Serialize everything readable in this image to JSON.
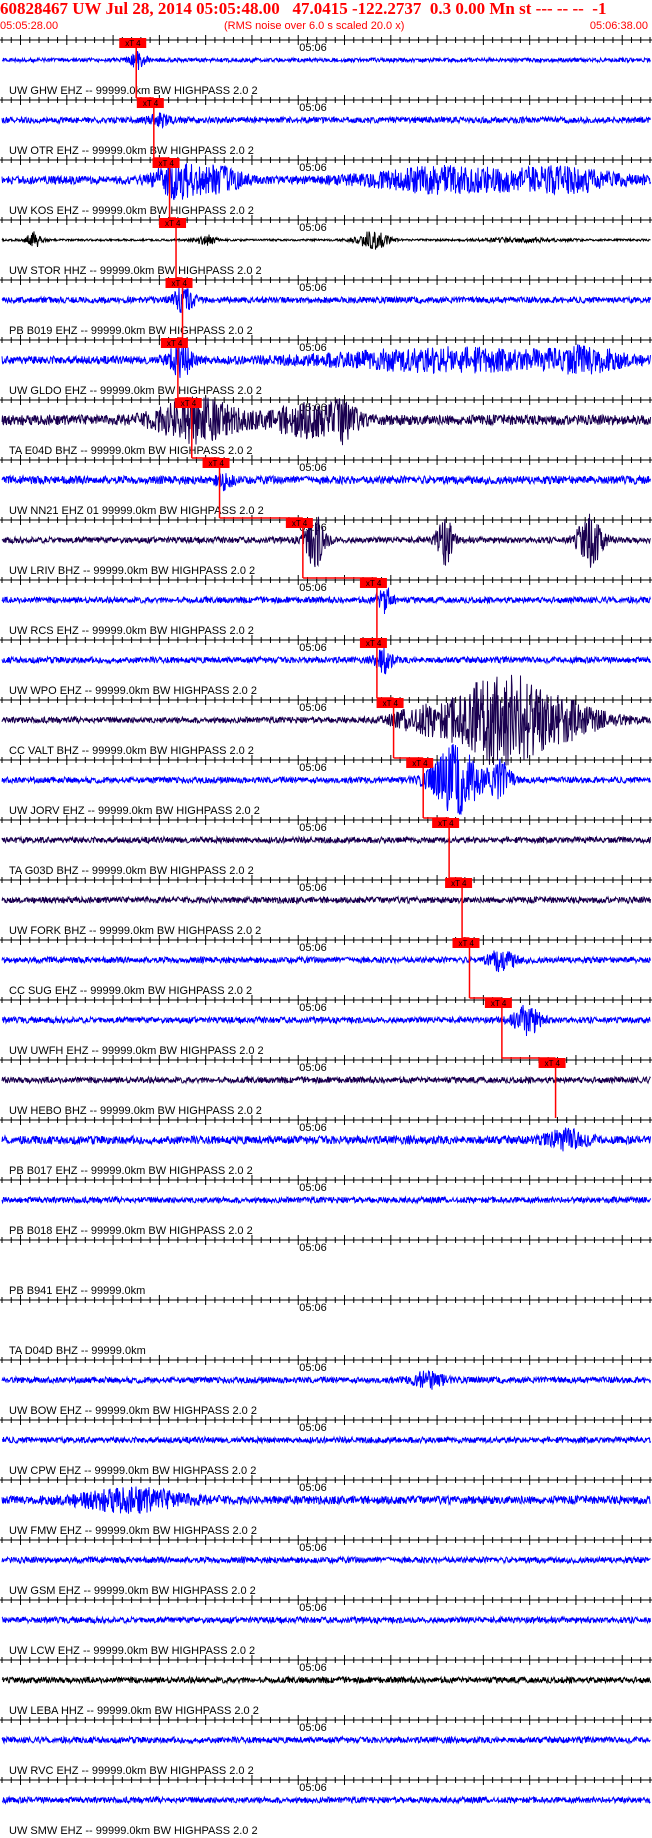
{
  "header": {
    "title": "60828467 UW Jul 28, 2014 05:05:48.00   47.0415 -122.2737  0.3 0.00 Mn st --- -- --  -1",
    "start_time": "05:05:28.00",
    "note": "(RMS noise over 6.0 s scaled 20.0 x)",
    "end_time": "05:06:38.00"
  },
  "colors": {
    "header": "#ff0000",
    "blue": "#0000ff",
    "dark": "#1a0050",
    "black": "#000000",
    "pick": "#ff0000",
    "axis": "#000000"
  },
  "chart_data": {
    "type": "line",
    "title": "60828467 UW Jul 28, 2014 05:05:48.00   47.0415 -122.2737  0.3 0.00 Mn st --- -- --  -1",
    "x_range": [
      "05:05:28.00",
      "05:06:38.00"
    ],
    "tick_label": "05:06",
    "tick_label_time": "05:06:00",
    "tick_interval_s": 1,
    "pick_label": "xT 4",
    "grid": false,
    "legend": "none",
    "traces": [
      {
        "label": "UW GHW EHZ -- 99999.0km BW  HIGHPASS  2.0  2",
        "color": "blue",
        "amp": 2,
        "pick": 14.5,
        "events": [
          {
            "t": 14.6,
            "a": 9,
            "w": 0.6
          }
        ]
      },
      {
        "label": "UW OTR EHZ -- 99999.0km BW  HIGHPASS  2.0  2",
        "color": "blue",
        "amp": 3,
        "pick": 16.4,
        "events": [
          {
            "t": 17,
            "a": 5,
            "w": 0.8
          }
        ]
      },
      {
        "label": "UW KOS EHZ -- 99999.0km BW  HIGHPASS  2.0  2",
        "color": "blue",
        "amp": 4,
        "pick": 18.1,
        "events": [
          {
            "t": 18.6,
            "a": 16,
            "w": 1.5
          },
          {
            "t": 23,
            "a": 12,
            "w": 2
          },
          {
            "t": 48,
            "a": 11,
            "w": 6
          },
          {
            "t": 61,
            "a": 10,
            "w": 4
          }
        ]
      },
      {
        "label": "UW STOR HHZ -- 99999.0km BW  HIGHPASS  2.0  2",
        "color": "black",
        "amp": 1,
        "pick": 18.8,
        "events": [
          {
            "t": 3.5,
            "a": 8,
            "w": 0.6
          },
          {
            "t": 22,
            "a": 5,
            "w": 0.8
          },
          {
            "t": 40,
            "a": 9,
            "w": 1.2
          },
          {
            "t": 56,
            "a": 2,
            "w": 3
          }
        ]
      },
      {
        "label": "PB B019 EHZ -- 99999.0km BW  HIGHPASS  2.0  2",
        "color": "blue",
        "amp": 3,
        "pick": 19.5,
        "events": [
          {
            "t": 19.6,
            "a": 11,
            "w": 0.8
          }
        ]
      },
      {
        "label": "UW GLDO EHZ -- 99999.0km BW  HIGHPASS  2.0  2",
        "color": "blue",
        "amp": 4,
        "pick": 19,
        "events": [
          {
            "t": 19.3,
            "a": 14,
            "w": 1
          },
          {
            "t": 48,
            "a": 10,
            "w": 9
          },
          {
            "t": 63,
            "a": 9,
            "w": 3
          }
        ]
      },
      {
        "label": "TA E04D BHZ -- 99999.0km BW  HIGHPASS  2.0  2",
        "color": "dark",
        "amp": 5,
        "pick": 20.5,
        "events": [
          {
            "t": 21,
            "a": 20,
            "w": 3
          },
          {
            "t": 33,
            "a": 14,
            "w": 3
          },
          {
            "t": 37,
            "a": 17,
            "w": 0.8
          }
        ]
      },
      {
        "label": "UW NN21 EHZ 01 99999.0km BW  HIGHPASS  2.0  2",
        "color": "blue",
        "amp": 4,
        "pick": 23.5,
        "events": [
          {
            "t": 24,
            "a": 8,
            "w": 0.6
          }
        ]
      },
      {
        "label": "UW LRIV BHZ -- 99999.0km BW  HIGHPASS  2.0  2",
        "color": "dark",
        "amp": 3,
        "pick": 32.5,
        "events": [
          {
            "t": 33.8,
            "a": 26,
            "w": 0.8
          },
          {
            "t": 47.8,
            "a": 24,
            "w": 0.6
          },
          {
            "t": 63.5,
            "a": 26,
            "w": 0.9
          }
        ]
      },
      {
        "label": "UW RCS EHZ -- 99999.0km BW  HIGHPASS  2.0  2",
        "color": "blue",
        "amp": 3,
        "pick": 40.5,
        "events": [
          {
            "t": 41.3,
            "a": 12,
            "w": 0.6
          }
        ]
      },
      {
        "label": "UW WPO EHZ -- 99999.0km BW  HIGHPASS  2.0  2",
        "color": "blue",
        "amp": 3,
        "pick": 40.5,
        "events": [
          {
            "t": 41.2,
            "a": 13,
            "w": 0.6
          }
        ]
      },
      {
        "label": "CC VALT BHZ -- 99999.0km BW  HIGHPASS  2.0  2",
        "color": "dark",
        "amp": 3,
        "pick": 42.3,
        "events": [
          {
            "t": 45,
            "a": 10,
            "w": 2
          },
          {
            "t": 53,
            "a": 38,
            "w": 3.5
          },
          {
            "t": 59,
            "a": 20,
            "w": 4
          }
        ]
      },
      {
        "label": "UW JORV EHZ -- 99999.0km BW  HIGHPASS  2.0  2",
        "color": "blue",
        "amp": 3,
        "pick": 45.5,
        "events": [
          {
            "t": 49,
            "a": 34,
            "w": 1.8
          },
          {
            "t": 53.8,
            "a": 18,
            "w": 0.8
          }
        ]
      },
      {
        "label": "TA G03D BHZ -- 99999.0km BW  HIGHPASS  2.0  2",
        "color": "dark",
        "amp": 3,
        "pick": 48.3,
        "events": []
      },
      {
        "label": "UW FORK BHZ -- 99999.0km BW  HIGHPASS  2.0  2",
        "color": "dark",
        "amp": 3,
        "pick": 49.7,
        "events": []
      },
      {
        "label": "CC SUG EHZ -- 99999.0km BW  HIGHPASS  2.0  2",
        "color": "blue",
        "amp": 3,
        "pick": 50.5,
        "events": [
          {
            "t": 54,
            "a": 10,
            "w": 1
          }
        ]
      },
      {
        "label": "UW UWFH EHZ -- 99999.0km BW  HIGHPASS  2.0  2",
        "color": "blue",
        "amp": 3,
        "pick": 54,
        "events": [
          {
            "t": 56.7,
            "a": 14,
            "w": 1
          }
        ]
      },
      {
        "label": "UW HEBO BHZ -- 99999.0km BW  HIGHPASS  2.0  2",
        "color": "dark",
        "amp": 3,
        "pick": 59.8,
        "events": []
      },
      {
        "label": "PB B017 EHZ -- 99999.0km BW  HIGHPASS  2.0  2",
        "color": "blue",
        "amp": 4,
        "pick": null,
        "events": [
          {
            "t": 61,
            "a": 9,
            "w": 1.5
          }
        ]
      },
      {
        "label": "PB B018 EHZ -- 99999.0km BW  HIGHPASS  2.0  2",
        "color": "blue",
        "amp": 3,
        "pick": null,
        "events": []
      },
      {
        "label": "PB B941 EHZ -- 99999.0km",
        "color": "none",
        "amp": 0,
        "pick": null,
        "events": []
      },
      {
        "label": "TA D04D BHZ -- 99999.0km",
        "color": "none",
        "amp": 0,
        "pick": null,
        "events": []
      },
      {
        "label": "UW BOW EHZ -- 99999.0km BW  HIGHPASS  2.0  2",
        "color": "blue",
        "amp": 3,
        "pick": null,
        "events": [
          {
            "t": 46,
            "a": 8,
            "w": 1.2
          }
        ]
      },
      {
        "label": "UW CPW EHZ -- 99999.0km BW  HIGHPASS  2.0  2",
        "color": "blue",
        "amp": 3,
        "pick": null,
        "events": []
      },
      {
        "label": "UW FMW EHZ -- 99999.0km BW  HIGHPASS  2.0  2",
        "color": "blue",
        "amp": 4,
        "pick": null,
        "events": [
          {
            "t": 14,
            "a": 10,
            "w": 4
          }
        ]
      },
      {
        "label": "UW GSM EHZ -- 99999.0km BW  HIGHPASS  2.0  2",
        "color": "blue",
        "amp": 3,
        "pick": null,
        "events": []
      },
      {
        "label": "UW LCW EHZ -- 99999.0km BW  HIGHPASS  2.0  2",
        "color": "blue",
        "amp": 3,
        "pick": null,
        "events": []
      },
      {
        "label": "UW LEBA HHZ -- 99999.0km BW  HIGHPASS  2.0  2",
        "color": "black",
        "amp": 3,
        "pick": null,
        "events": []
      },
      {
        "label": "UW RVC EHZ -- 99999.0km BW  HIGHPASS  2.0  2",
        "color": "blue",
        "amp": 3,
        "pick": null,
        "events": []
      },
      {
        "label": "UW SMW EHZ -- 99999.0km BW  HIGHPASS  2.0  2",
        "color": "blue",
        "amp": 3,
        "pick": null,
        "events": []
      }
    ]
  }
}
